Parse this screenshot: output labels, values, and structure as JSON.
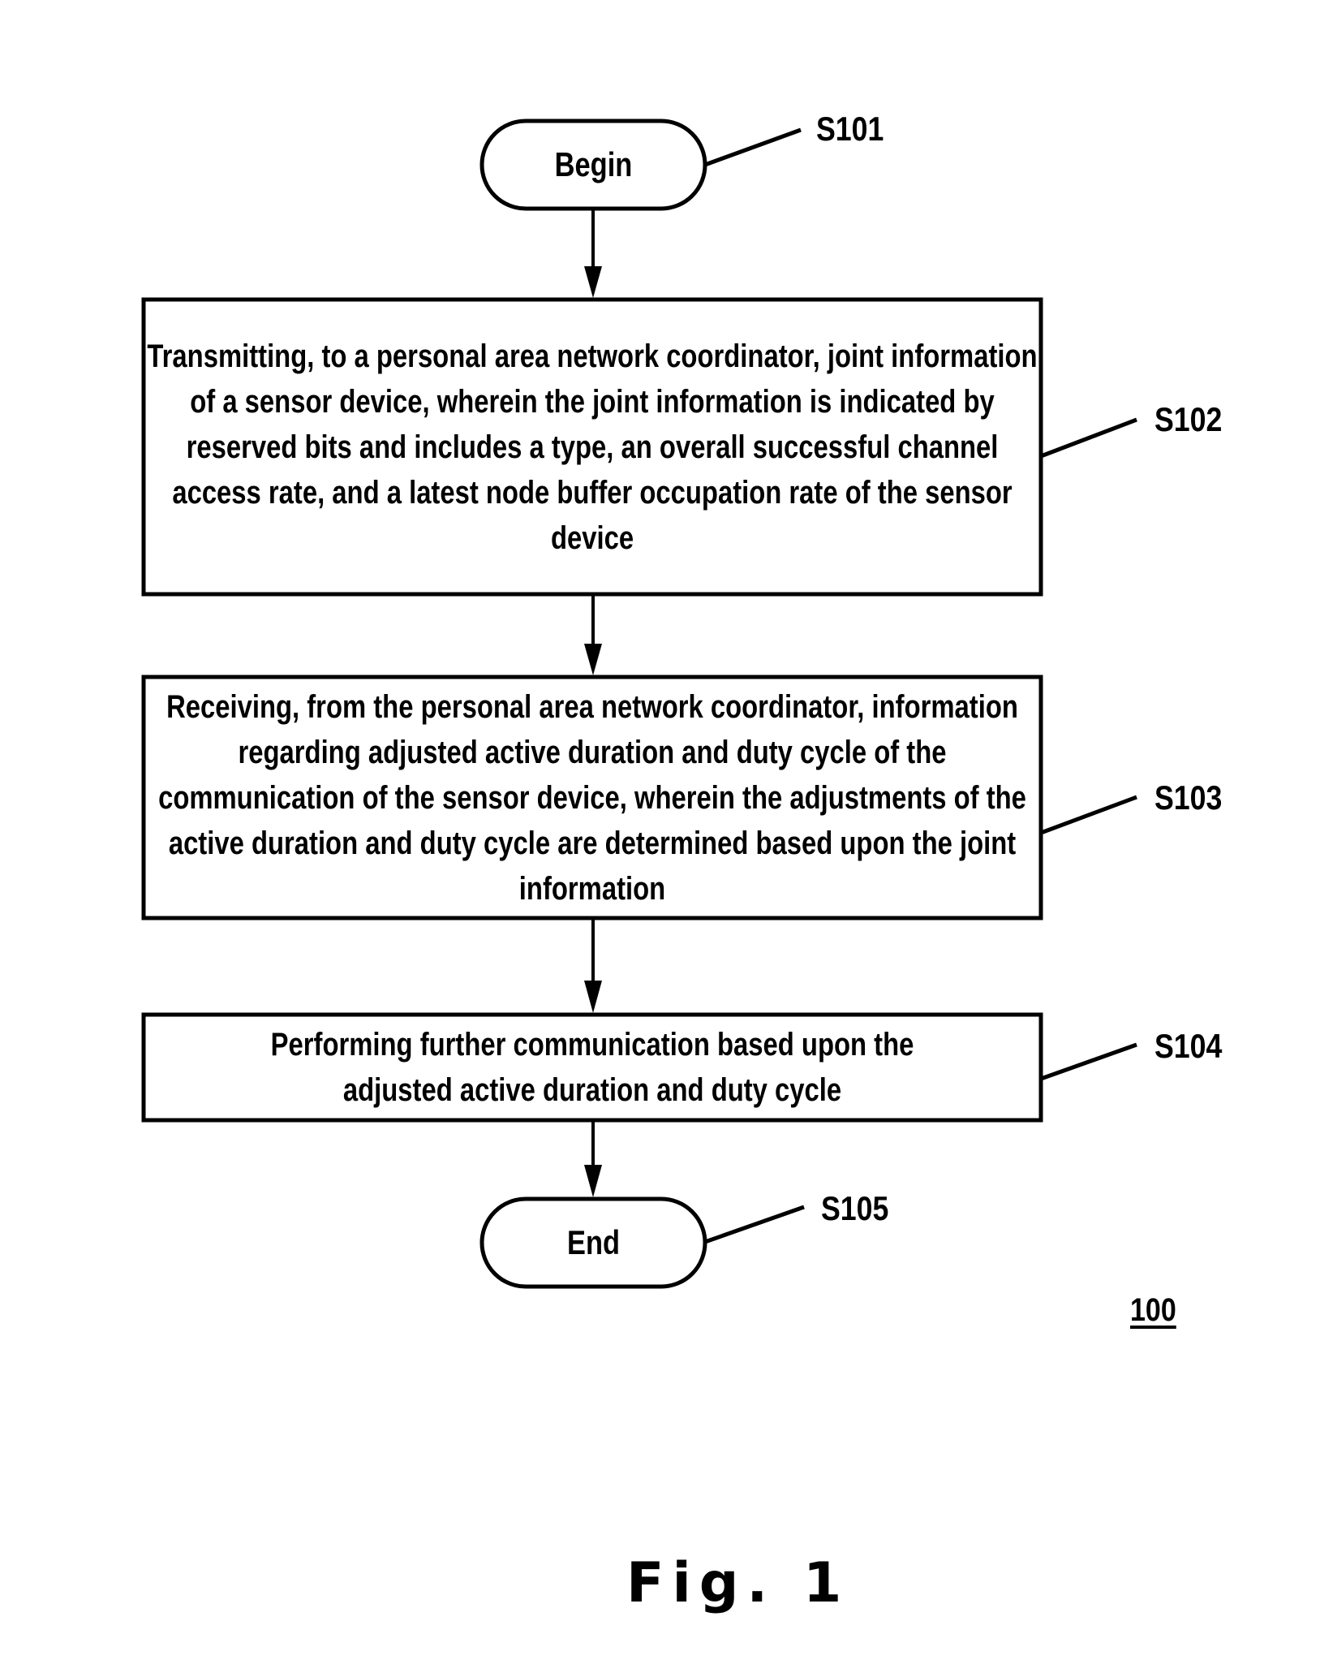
{
  "figure": {
    "title": "Fig. 1",
    "reference_number": "100"
  },
  "nodes": [
    {
      "id": "S101",
      "type": "terminal",
      "text": "Begin"
    },
    {
      "id": "S102",
      "type": "process",
      "text": "Transmitting, to a personal area network coordinator, joint information of a sensor device, wherein the joint information is indicated by reserved bits and includes a type, an overall successful channel access rate, and a latest node buffer occupation rate of the sensor device"
    },
    {
      "id": "S103",
      "type": "process",
      "text": "Receiving, from the personal area network coordinator, information regarding adjusted active duration and duty cycle of the communication of the sensor device, wherein the adjustments of the active duration and duty cycle are determined based upon the joint information"
    },
    {
      "id": "S104",
      "type": "process",
      "text": "Performing further communication based upon the adjusted active duration and duty cycle"
    },
    {
      "id": "S105",
      "type": "terminal",
      "text": "End"
    }
  ],
  "edges": [
    {
      "from": "S101",
      "to": "S102"
    },
    {
      "from": "S102",
      "to": "S103"
    },
    {
      "from": "S103",
      "to": "S104"
    },
    {
      "from": "S104",
      "to": "S105"
    }
  ],
  "colors": {
    "stroke": "#000000",
    "background": "#ffffff"
  }
}
